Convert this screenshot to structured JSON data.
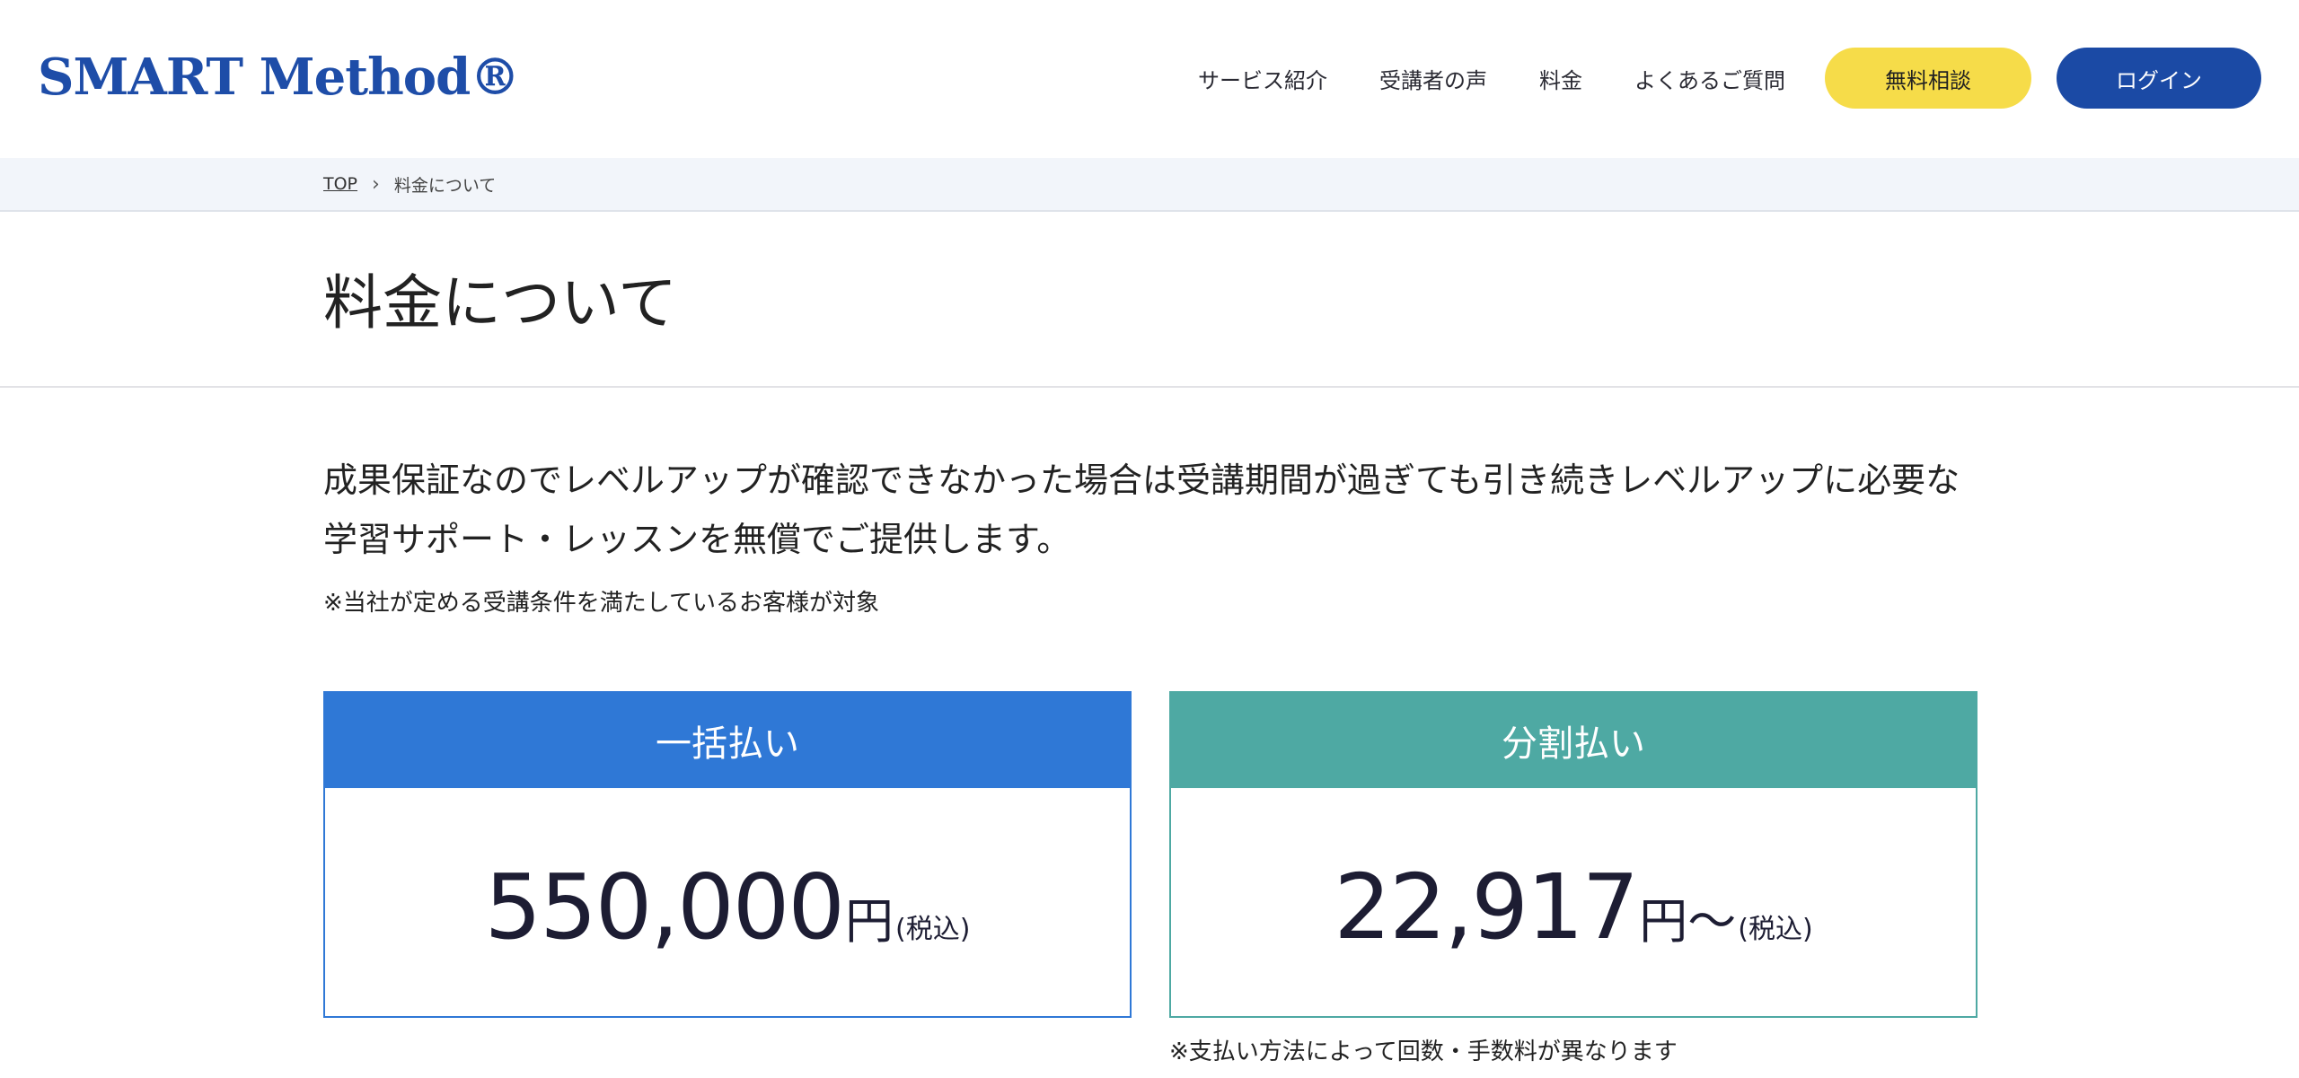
{
  "header": {
    "logo": "SMART Method®",
    "nav": [
      "サービス紹介",
      "受講者の声",
      "料金",
      "よくあるご質問"
    ],
    "consult_button": "無料相談",
    "login_button": "ログイン"
  },
  "breadcrumb": {
    "top": "TOP",
    "separator": "›",
    "current": "料金について"
  },
  "page_title": "料金について",
  "lead": {
    "text": "成果保証なのでレベルアップが確認できなかった場合は受講期間が過ぎても引き続きレベルアップに必要な学習サポート・レッスンを無償でご提供します。",
    "note": "※当社が定める受講条件を満たしているお客様が対象"
  },
  "pricing": {
    "lump": {
      "title": "一括払い",
      "amount": "550,000",
      "unit": "円",
      "tax": "(税込)"
    },
    "split": {
      "title": "分割払い",
      "amount": "22,917",
      "unit": "円〜",
      "tax": "(税込)",
      "note": "※支払い方法によって回数・手数料が異なります"
    }
  },
  "colors": {
    "brand_blue": "#1b4aa5",
    "accent_yellow": "#f6dc49",
    "lump_blue": "#2f78d6",
    "split_teal": "#4ea9a3"
  }
}
